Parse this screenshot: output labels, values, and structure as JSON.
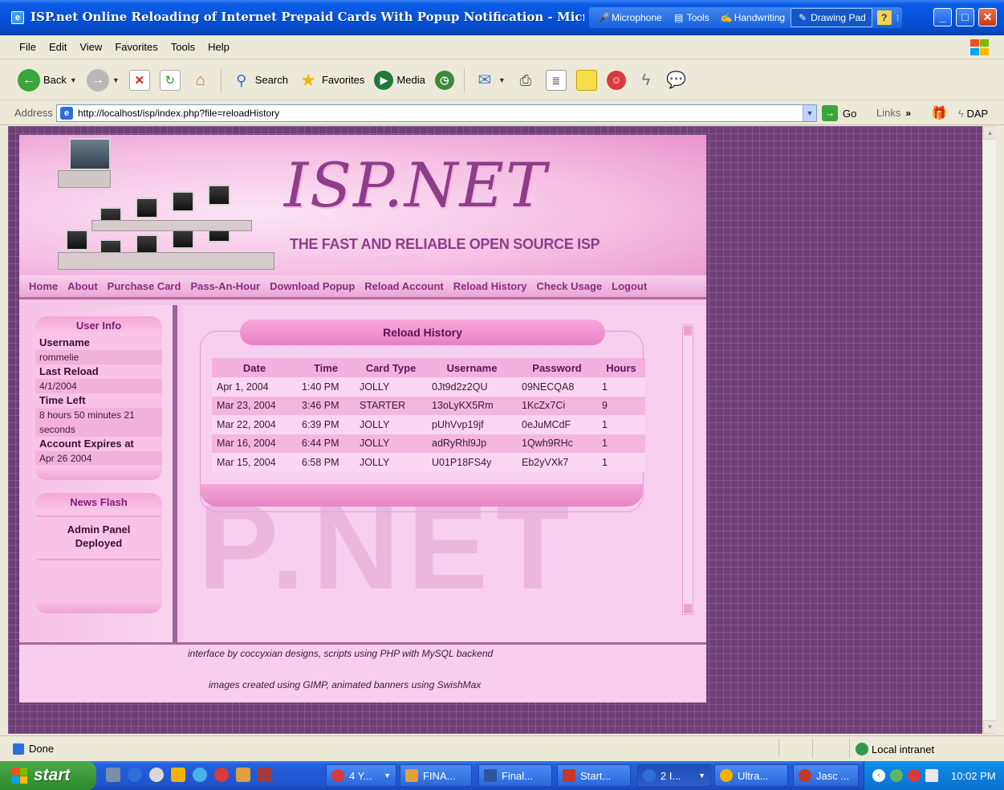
{
  "window": {
    "title": "ISP.net Online Reloading of Internet Prepaid Cards With Popup Notification - Microsoft Inter",
    "language_bar": [
      {
        "label": "Microphone",
        "icon": "microphone-icon"
      },
      {
        "label": "Tools",
        "icon": "tools-icon"
      },
      {
        "label": "Handwriting",
        "icon": "handwriting-icon"
      },
      {
        "label": "Drawing Pad",
        "icon": "drawing-pad-icon"
      }
    ],
    "help": "?"
  },
  "menubar": [
    "File",
    "Edit",
    "View",
    "Favorites",
    "Tools",
    "Help"
  ],
  "toolbar": {
    "back": "Back",
    "search": "Search",
    "favorites": "Favorites",
    "media": "Media"
  },
  "address": {
    "label": "Address",
    "url": "http://localhost/isp/index.php?file=reloadHistory",
    "go": "Go",
    "links": "Links",
    "links_chevron": "»",
    "dap": "DAP"
  },
  "site": {
    "logo": "ISP.NET",
    "tagline": "THE FAST AND RELIABLE OPEN SOURCE ISP",
    "watermark": "P.NET",
    "nav": [
      "Home",
      "About",
      "Purchase Card",
      "Pass-An-Hour",
      "Download Popup",
      "Reload Account",
      "Reload History",
      "Check Usage",
      "Logout"
    ],
    "user_info": {
      "title": "User Info",
      "username_label": "Username",
      "username": "rommelie",
      "last_reload_label": "Last Reload",
      "last_reload": "4/1/2004",
      "time_left_label": "Time Left",
      "time_left_1": "8 hours 50 minutes 21",
      "time_left_2": "seconds",
      "expires_label": "Account Expires at",
      "expires": "Apr 26 2004"
    },
    "news": {
      "title": "News Flash",
      "line1": "Admin Panel",
      "line2": "Deployed"
    },
    "reload_history": {
      "title": "Reload History",
      "columns": [
        "Date",
        "Time",
        "Card Type",
        "Username",
        "Password",
        "Hours"
      ],
      "rows": [
        [
          "Apr 1, 2004",
          "1:40 PM",
          "JOLLY",
          "0Jt9d2z2QU",
          "09NECQA8",
          "1"
        ],
        [
          "Mar 23, 2004",
          "3:46 PM",
          "STARTER",
          "13oLyKX5Rm",
          "1KcZx7Ci",
          "9"
        ],
        [
          "Mar 22, 2004",
          "6:39 PM",
          "JOLLY",
          "pUhVvp19jf",
          "0eJuMCdF",
          "1"
        ],
        [
          "Mar 16, 2004",
          "6:44 PM",
          "JOLLY",
          "adRyRhl9Jp",
          "1Qwh9RHc",
          "1"
        ],
        [
          "Mar 15, 2004",
          "6:58 PM",
          "JOLLY",
          "U01P18FS4y",
          "Eb2yVXk7",
          "1"
        ]
      ]
    },
    "footer": {
      "line1": "interface by coccyxian designs, scripts using PHP with MySQL backend",
      "line2": "images created using GIMP, animated banners using SwishMax"
    }
  },
  "status": {
    "text": "Done",
    "zone": "Local intranet"
  },
  "taskbar": {
    "start": "start",
    "tasks": [
      "4 Y...",
      "FINA...",
      "Final...",
      "Start...",
      "2 I...",
      "Ultra...",
      "Jasc ..."
    ],
    "clock": "10:02 PM"
  },
  "colors": {
    "title_bar": "#0653d9",
    "nav_link": "#8a2c82",
    "site_background": "#f6c5ea",
    "page_background": "#6f3f77",
    "start_button": "#2d8a2d"
  }
}
